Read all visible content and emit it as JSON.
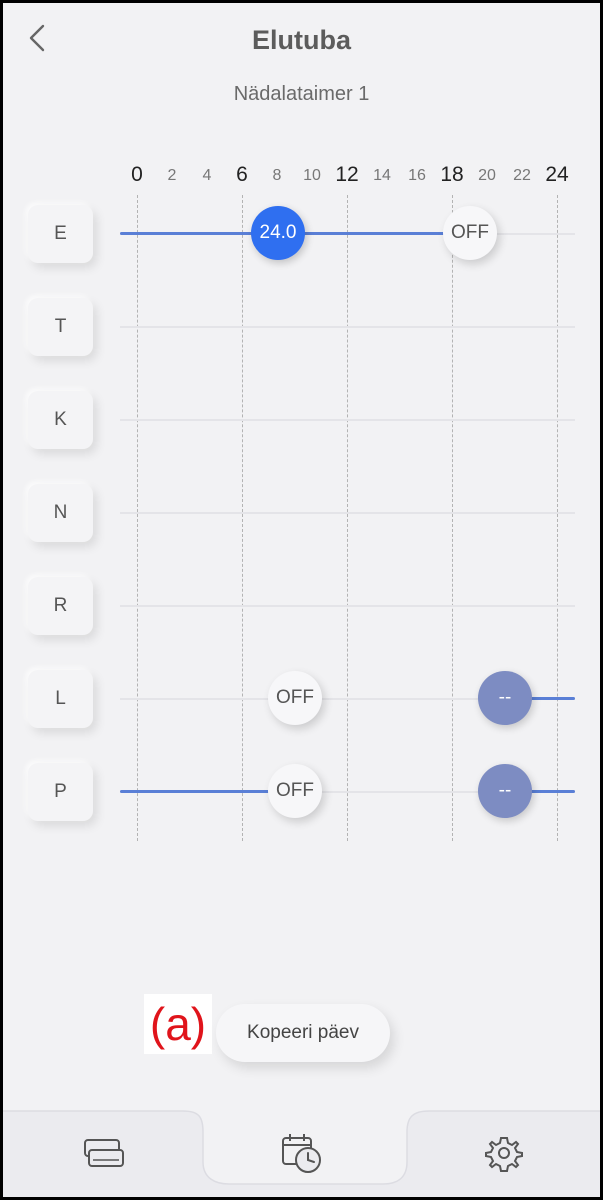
{
  "header": {
    "title": "Elutuba",
    "subtitle": "Nädalataimer 1"
  },
  "axis": {
    "ticks": [
      {
        "label": "0",
        "major": true
      },
      {
        "label": "2",
        "major": false
      },
      {
        "label": "4",
        "major": false
      },
      {
        "label": "6",
        "major": true
      },
      {
        "label": "8",
        "major": false
      },
      {
        "label": "10",
        "major": false
      },
      {
        "label": "12",
        "major": true
      },
      {
        "label": "14",
        "major": false
      },
      {
        "label": "16",
        "major": false
      },
      {
        "label": "18",
        "major": true
      },
      {
        "label": "20",
        "major": false
      },
      {
        "label": "22",
        "major": false
      },
      {
        "label": "24",
        "major": true
      }
    ]
  },
  "days": [
    {
      "label": "E"
    },
    {
      "label": "T"
    },
    {
      "label": "K"
    },
    {
      "label": "N"
    },
    {
      "label": "R"
    },
    {
      "label": "L"
    },
    {
      "label": "P"
    }
  ],
  "schedule": {
    "E": {
      "handle_1": "24.0",
      "handle_2": "OFF"
    },
    "L": {
      "handle_1": "OFF",
      "handle_2": "--"
    },
    "P": {
      "handle_1": "OFF",
      "handle_2": "--"
    }
  },
  "annotation": "(a)",
  "copy_button": "Kopeeri päev",
  "icons": {
    "back": "chevron-left-icon",
    "nav_devices": "devices-icon",
    "nav_schedule": "calendar-clock-icon",
    "nav_settings": "gear-icon"
  },
  "colors": {
    "accent": "#2f6ff0",
    "line": "#5a7fd6",
    "slate_handle": "#7d8cc2",
    "annotation": "#e0141b"
  }
}
